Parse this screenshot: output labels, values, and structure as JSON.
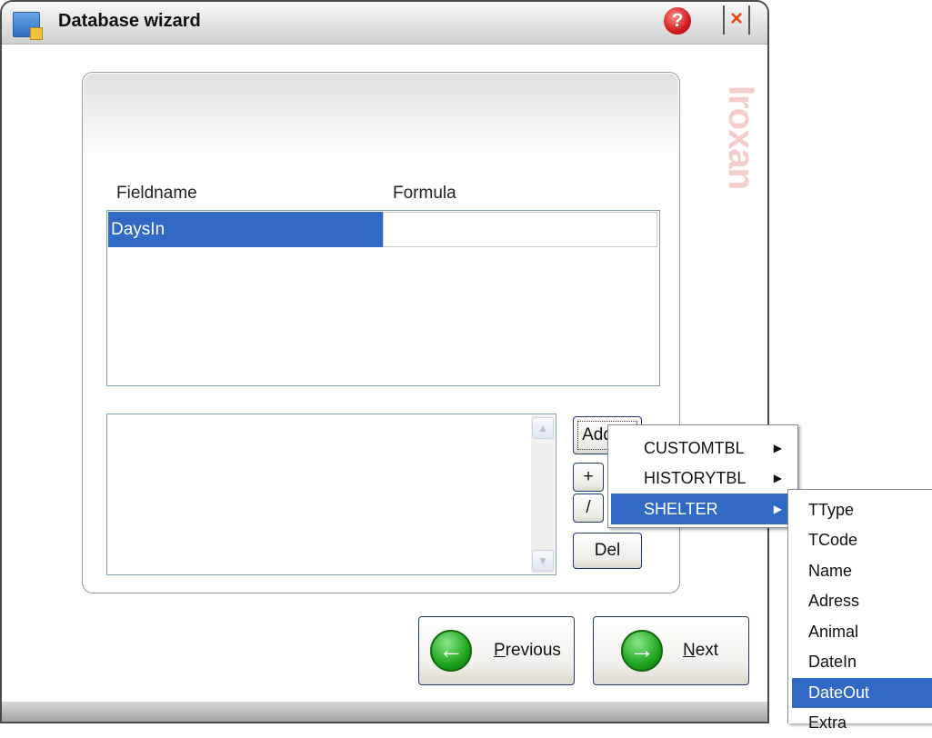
{
  "window": {
    "title": "Database wizard",
    "help_glyph": "?",
    "close_glyph": "×"
  },
  "watermark": "Iroxan",
  "grid": {
    "columns": [
      "Fieldname",
      "Formula"
    ],
    "rows": [
      {
        "fieldname": "DaysIn",
        "formula": ""
      }
    ]
  },
  "buttons": {
    "add": "Add",
    "plus": "+",
    "divide": "/",
    "del": "Del",
    "previous": "Previous",
    "next": "Next"
  },
  "menu": {
    "items": [
      "CUSTOMTBL",
      "HISTORYTBL",
      "SHELTER"
    ],
    "selected": "SHELTER"
  },
  "submenu": {
    "items": [
      "TType",
      "TCode",
      "Name",
      "Adress",
      "Animal",
      "DateIn",
      "DateOut",
      "Extra"
    ],
    "selected": "DateOut"
  },
  "colors": {
    "selection": "#316ac5",
    "button_border": "#1d3a75",
    "watermark": "#f4c8c8"
  },
  "icons": [
    "app-icon",
    "help-icon",
    "close-icon",
    "previous-arrow-icon",
    "next-arrow-icon",
    "submenu-arrow-icon"
  ]
}
